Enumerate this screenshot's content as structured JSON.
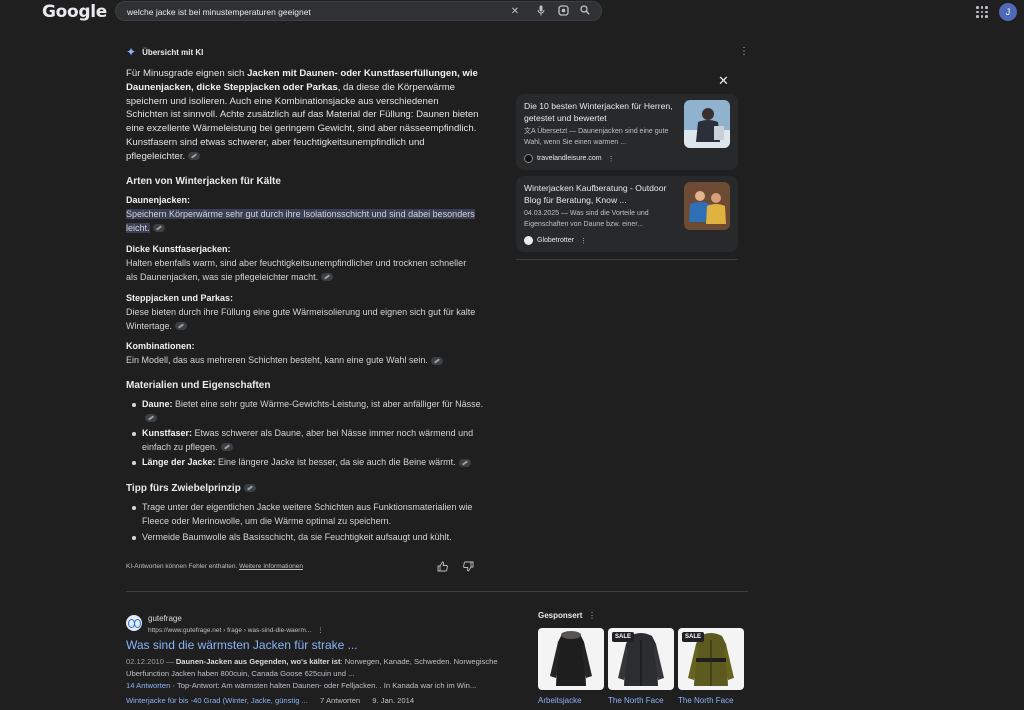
{
  "header": {
    "logo": "Google",
    "query": "welche jacke ist bei minustemperaturen geeignet",
    "avatar": "J"
  },
  "ai": {
    "heading": "Übersicht mit KI",
    "intro": {
      "p1": "Für Minusgrade eignen sich ",
      "b1": "Jacken mit Daunen- oder Kunstfaserfüllungen, wie Daunenjacken, dicke Steppjacken oder Parkas",
      "p2": ", da diese die Körperwärme speichern und isolieren. Auch eine Kombinationsjacke aus verschiedenen Schichten ist sinnvoll. Achte zusätzlich auf das Material der Füllung: Daunen bieten eine exzellente Wärmeleistung bei geringem Gewicht, sind aber nässeempfindlich. Kunstfasern sind etwas schwerer, aber feuchtigkeitsunempfindlich und pflegeleichter."
    },
    "section1": "Arten von Winterjacken für Kälte",
    "types": [
      {
        "title": "Daunenjacken:",
        "text": "Speichern Körperwärme sehr gut durch ihre Isolationsschicht und sind dabei besonders leicht."
      },
      {
        "title": "Dicke Kunstfaserjacken:",
        "text": "Halten ebenfalls warm, sind aber feuchtigkeitsunempfindlicher und trocknen schneller als Daunenjacken, was sie pflegeleichter macht."
      },
      {
        "title": "Steppjacken und Parkas:",
        "text": "Diese bieten durch ihre Füllung eine gute Wärmeisolierung und eignen sich gut für kalte Wintertage."
      },
      {
        "title": "Kombinationen:",
        "text": "Ein Modell, das aus mehreren Schichten besteht, kann eine gute Wahl sein."
      }
    ],
    "section2": "Materialien und Eigenschaften",
    "materials": [
      {
        "b": "Daune:",
        "t": " Bietet eine sehr gute Wärme-Gewichts-Leistung, ist aber anfälliger für Nässe."
      },
      {
        "b": "Kunstfaser:",
        "t": " Etwas schwerer als Daune, aber bei Nässe immer noch wärmend und einfach zu pflegen."
      },
      {
        "b": "Länge der Jacke:",
        "t": " Eine längere Jacke ist besser, da sie auch die Beine wärmt."
      }
    ],
    "section3": "Tipp fürs Zwiebelprinzip",
    "tips": [
      "Trage unter der eigentlichen Jacke weitere Schichten aus Funktionsmaterialien wie Fleece oder Merinowolle, um die Wärme optimal zu speichern.",
      "Vermeide Baumwolle als Basisschicht, da sie Feuchtigkeit aufsaugt und kühlt."
    ],
    "disclaimer": "KI-Antworten können Fehler enthalten. ",
    "more_info": "Weitere Informationen"
  },
  "sources": [
    {
      "title": "Die 10 besten Winterjacken für Herren, getestet und bewertet",
      "snippet": "文A Übersetzt — Daunenjacken sind eine gute Wahl, wenn Sie einen warmen ...",
      "site": "travelandleisure.com"
    },
    {
      "title": "Winterjacken Kaufberatung - Outdoor Blog für Beratung, Know ...",
      "snippet": "04.03.2025 — Was sind die Vorteile und Eigenschaften von Daune bzw. einer...",
      "site": "Globetrotter"
    }
  ],
  "result": {
    "site": "gutefrage",
    "url": "https://www.gutefrage.net › frage › was-sind-die-waerm...",
    "title": "Was sind die wärmsten Jacken für strake ...",
    "date": "02.12.2010 — ",
    "snippet_b": "Daunen-Jacken aus Gegenden, wo's kälter ist",
    "snippet_rest": ": Norwegen, Kanade, Schweden. Norwegische Uberfunction Jacken haben 800cuin, Canada Goose 625cuin und ...",
    "answers": "14 Antworten",
    "top_answer": " · Top-Antwort: Am wärmsten halten Daunen- oder Felljacken. . In Kanada war ich im Win...",
    "related_link": "Winterjacke für bis -40 Grad (Winter, Jacke, günstig ...",
    "related_answers": "7 Antworten",
    "related_date": "9. Jan. 2014"
  },
  "sponsored": {
    "label": "Gesponsert",
    "products": [
      {
        "name": "Arbeitsjacke",
        "sale": ""
      },
      {
        "name": "The North Face",
        "sale": "SALE"
      },
      {
        "name": "The North Face",
        "sale": "SALE"
      }
    ]
  }
}
